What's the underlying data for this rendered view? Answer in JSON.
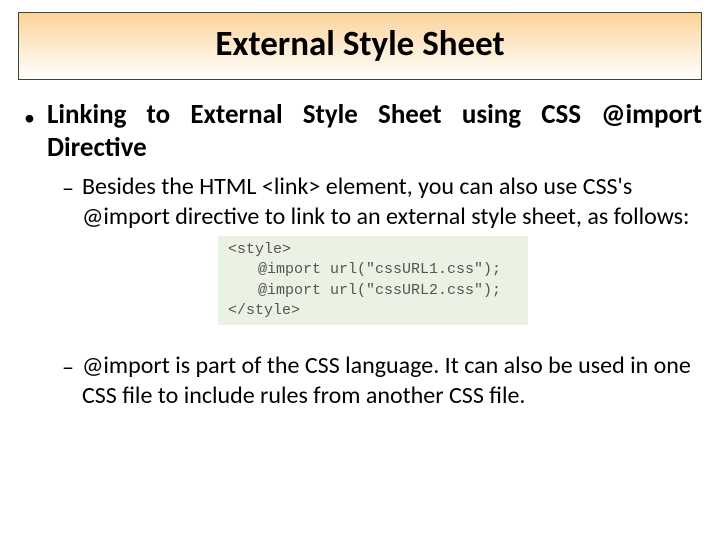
{
  "title": "External Style Sheet",
  "bullet1": {
    "label": "Linking to External Style Sheet using CSS @import Directive"
  },
  "sub1": {
    "text": "Besides the HTML <link> element, you can also use CSS's @import directive to link to an external style sheet, as follows:"
  },
  "code": {
    "line1": "<style>",
    "line2": "@import url(\"cssURL1.css\");",
    "line3": "@import url(\"cssURL2.css\");",
    "line4": "</style>"
  },
  "sub2": {
    "text": "@import is part of the CSS language. It can also be used in one CSS file to include rules from another CSS file."
  }
}
